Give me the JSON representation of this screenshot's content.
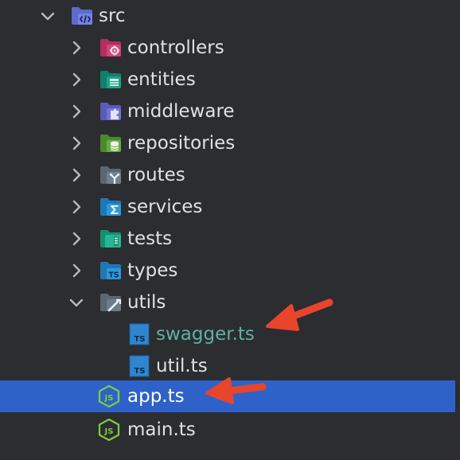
{
  "tree": {
    "src": {
      "label": "src",
      "icon": "source-folder-icon",
      "expanded": true
    },
    "folders": [
      {
        "label": "controllers",
        "icon": "controllers-folder-icon",
        "color": "#c73a6b"
      },
      {
        "label": "entities",
        "icon": "entities-folder-icon",
        "color": "#1e9478"
      },
      {
        "label": "middleware",
        "icon": "middleware-folder-icon",
        "color": "#6f6fcf"
      },
      {
        "label": "repositories",
        "icon": "repositories-folder-icon",
        "color": "#5e9e3a"
      },
      {
        "label": "routes",
        "icon": "routes-folder-icon",
        "color": "#6a7a86"
      },
      {
        "label": "services",
        "icon": "services-folder-icon",
        "color": "#2a8fd1"
      },
      {
        "label": "tests",
        "icon": "tests-folder-icon",
        "color": "#1fa884"
      },
      {
        "label": "types",
        "icon": "types-folder-icon",
        "color": "#2a8fd1"
      }
    ],
    "utils": {
      "label": "utils",
      "icon": "utils-folder-icon",
      "expanded": true
    },
    "utils_files": [
      {
        "label": "swagger.ts",
        "icon": "typescript-file-icon",
        "modified": true
      },
      {
        "label": "util.ts",
        "icon": "typescript-file-icon",
        "modified": false
      }
    ],
    "root_files": [
      {
        "label": "app.ts",
        "icon": "nodejs-file-icon",
        "selected": true
      },
      {
        "label": "main.ts",
        "icon": "nodejs-file-icon",
        "selected": false
      }
    ]
  },
  "colors": {
    "background": "#2b2d30",
    "selection": "#2e62c9",
    "text": "#dfe1e5",
    "modified_text": "#5fb0a2",
    "annotation_arrow": "#e8452c"
  }
}
